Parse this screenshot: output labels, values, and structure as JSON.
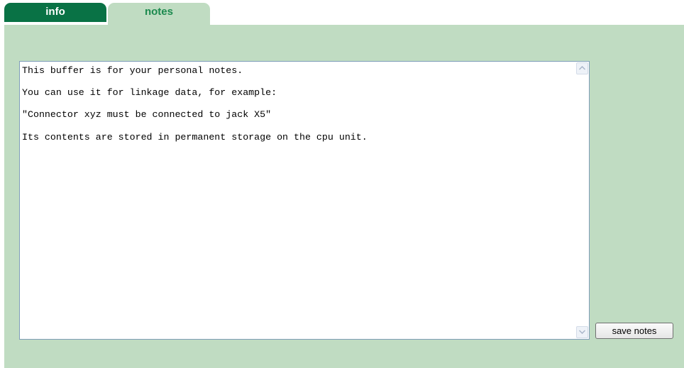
{
  "tabs": [
    {
      "label": "info",
      "active": false
    },
    {
      "label": "notes",
      "active": true
    }
  ],
  "colors": {
    "tab_inactive_bg": "#097245",
    "tab_active_bg": "#c0dcc2",
    "panel_bg": "#c0dcc2",
    "tab_active_text": "#1c8a4e"
  },
  "notes": {
    "value": "This buffer is for your personal notes.\n\nYou can use it for linkage data, for example:\n\n\"Connector xyz must be connected to jack X5\"\n\nIts contents are stored in permanent storage on the cpu unit."
  },
  "actions": {
    "save_label": "save notes"
  },
  "icons": {
    "scroll_up": "chevron-up-icon",
    "scroll_down": "chevron-down-icon"
  }
}
